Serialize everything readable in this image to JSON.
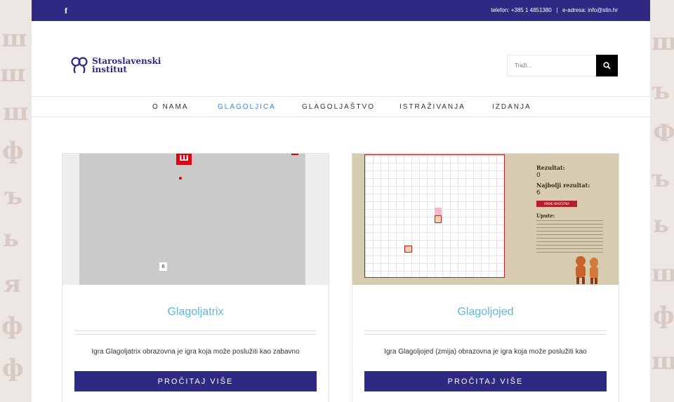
{
  "topbar": {
    "social_icon": "f",
    "contact": "telefon: +385 1 4851380   |   e-adresa: info@stin.hr"
  },
  "logo": {
    "line1": "Staroslavenski",
    "line2": "institut"
  },
  "search": {
    "placeholder": "Traži..."
  },
  "nav": {
    "items": [
      {
        "label": "O NAMA"
      },
      {
        "label": "GLAGOLJICA"
      },
      {
        "label": "GLAGOLJAŠTVO"
      },
      {
        "label": "ISTRAŽIVANJA"
      },
      {
        "label": "IZDANJA"
      }
    ]
  },
  "cards": [
    {
      "title": "Glagoljatrix",
      "text": "Igra Glagoljatrix obrazovna je igra koja može poslužiti kao zabavno",
      "button": "PROČITAJ VIŠE",
      "game_glyph": "Ш",
      "score_glyph": "6"
    },
    {
      "title": "Glagoljojed",
      "text": "Igra Glagoljojed (zmija) obrazovna je igra koja može poslužiti kao",
      "button": "PROČITAJ VIŠE",
      "score_label": "Rezultat:",
      "score": "0",
      "best_label": "Najbolji rezultat:",
      "best": "6",
      "new_game": "KRENI ISPOČETKA",
      "instructions_title": "Upute:"
    }
  ],
  "colors": {
    "brand": "#2e2a83",
    "accent": "#3a86c8",
    "title": "#5fb6d8"
  }
}
